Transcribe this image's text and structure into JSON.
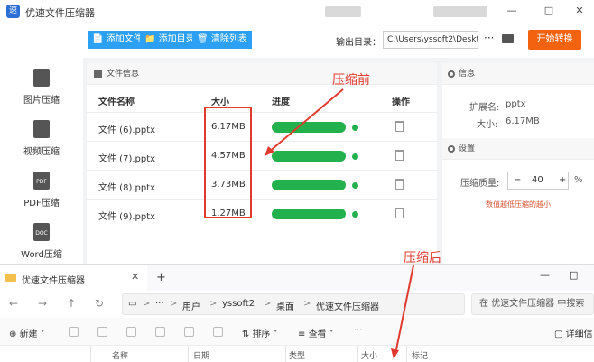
{
  "app": {
    "title": "优速文件压缩器",
    "window_buttons": [
      "—",
      "□",
      "✕"
    ]
  },
  "toolbar": {
    "add_file": "添加文件",
    "add_folder": "添加目录",
    "clear_list": "清除列表",
    "output_label": "输出目录：",
    "output_path": "C:\\Users\\yssoft2\\Deskt",
    "more": "···",
    "start": "开始转换"
  },
  "sidebar": {
    "items": [
      {
        "label": "图片压缩",
        "icon": "image-file-icon"
      },
      {
        "label": "视频压缩",
        "icon": "video-file-icon"
      },
      {
        "label": "PDF压缩",
        "icon": "pdf-file-icon",
        "badge": "PDF"
      },
      {
        "label": "Word压缩",
        "icon": "word-file-icon",
        "badge": "DOC"
      }
    ]
  },
  "file_panel": {
    "title": "文件信息",
    "headers": {
      "name": "文件名称",
      "size": "大小",
      "progress": "进度",
      "action": "操作"
    },
    "rows": [
      {
        "name": "文件 (6).pptx",
        "size": "6.17MB",
        "progress": 1.0
      },
      {
        "name": "文件 (7).pptx",
        "size": "4.57MB",
        "progress": 1.0
      },
      {
        "name": "文件 (8).pptx",
        "size": "3.73MB",
        "progress": 1.0
      },
      {
        "name": "文件 (9).pptx",
        "size": "1.27MB",
        "progress": 1.0
      }
    ]
  },
  "annotations": {
    "before": "压缩前",
    "after": "压缩后",
    "color": "#e03a2f"
  },
  "info": {
    "title": "信息",
    "ext_label": "扩展名:",
    "ext_value": "pptx",
    "size_label": "大小:",
    "size_value": "6.17MB"
  },
  "settings": {
    "title": "设置",
    "quality_label": "压缩质量:",
    "minus": "−",
    "quality_value": "40",
    "plus": "+",
    "unit": "%",
    "hint": "数值越低压缩的越小"
  },
  "explorer": {
    "tab_title": "优速文件压缩器",
    "tab_close": "✕",
    "new_tab": "+",
    "window_buttons": [
      "—",
      "□"
    ],
    "path": [
      "用户",
      "yssoft2",
      "桌面",
      "优速文件压缩器"
    ],
    "path_sep": ">",
    "path_more": "···",
    "search_placeholder": "在 优速文件压缩器 中搜索",
    "new_label": "新建",
    "sort_label": "排序",
    "view_label": "查看",
    "more": "···",
    "details_label": "详细信",
    "columns": [
      "名称",
      "日期",
      "类型",
      "大小",
      "标记"
    ]
  },
  "colors": {
    "accent_blue": "#2ba0f4",
    "start_orange": "#f3620f",
    "progress_green": "#22b14c"
  }
}
